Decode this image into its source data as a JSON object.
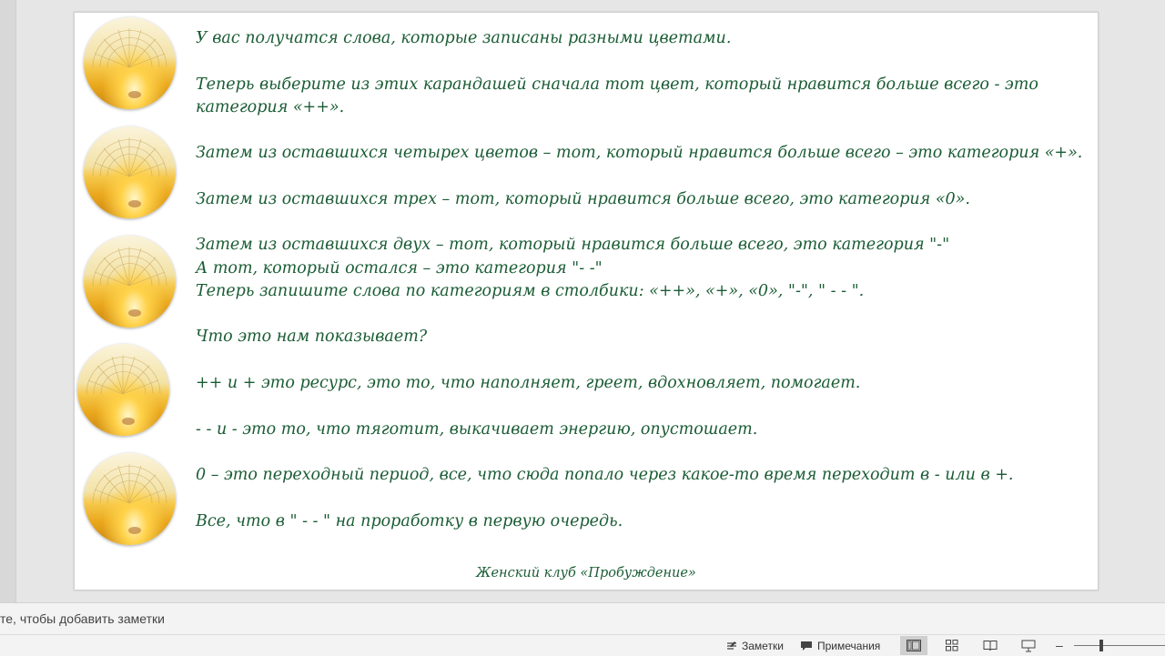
{
  "slide": {
    "lines": [
      "У вас получатся слова, которые записаны разными цветами.",
      "Теперь выберите из этих карандашей сначала тот цвет, который нравится больше всего - это",
      "категория «++».",
      "Затем из оставшихся четырех цветов – тот, который нравится больше всего – это категория «+».",
      "Затем из оставшихся трех – тот, который нравится больше всего, это категория «0».",
      "Затем из оставшихся двух – тот, который нравится больше всего, это категория \"-\"",
      "А тот, который остался – это категория \"- -\"",
      "Теперь запишите слова по категориям в столбики: «++», «+», «0», \"-\", \" - - \".",
      "Что это нам показывает?",
      "++ и + это ресурс, это то, что наполняет, греет, вдохновляет, помогает.",
      "- - и - это то, что тяготит, выкачивает энергию, опустошает.",
      "0 – это переходный период, все, что сюда попало через какое-то время переходит в - или в +.",
      "Все, что в \" - - \" на проработку в первую очередь."
    ],
    "signature": "Женский клуб «Пробуждение»",
    "colors": {
      "text": "#1a5c34",
      "slide_bg": "#ffffff"
    }
  },
  "notes": {
    "placeholder": "те, чтобы добавить заметки"
  },
  "status_bar": {
    "notes_label": "Заметки",
    "comments_label": "Примечания",
    "notes_icon": "notes-icon",
    "comments_icon": "comment-icon",
    "view_icons": [
      "normal-view-icon",
      "slide-sorter-icon",
      "reading-view-icon",
      "slideshow-icon"
    ],
    "zoom_minus": "–",
    "zoom_level": 0.28
  }
}
